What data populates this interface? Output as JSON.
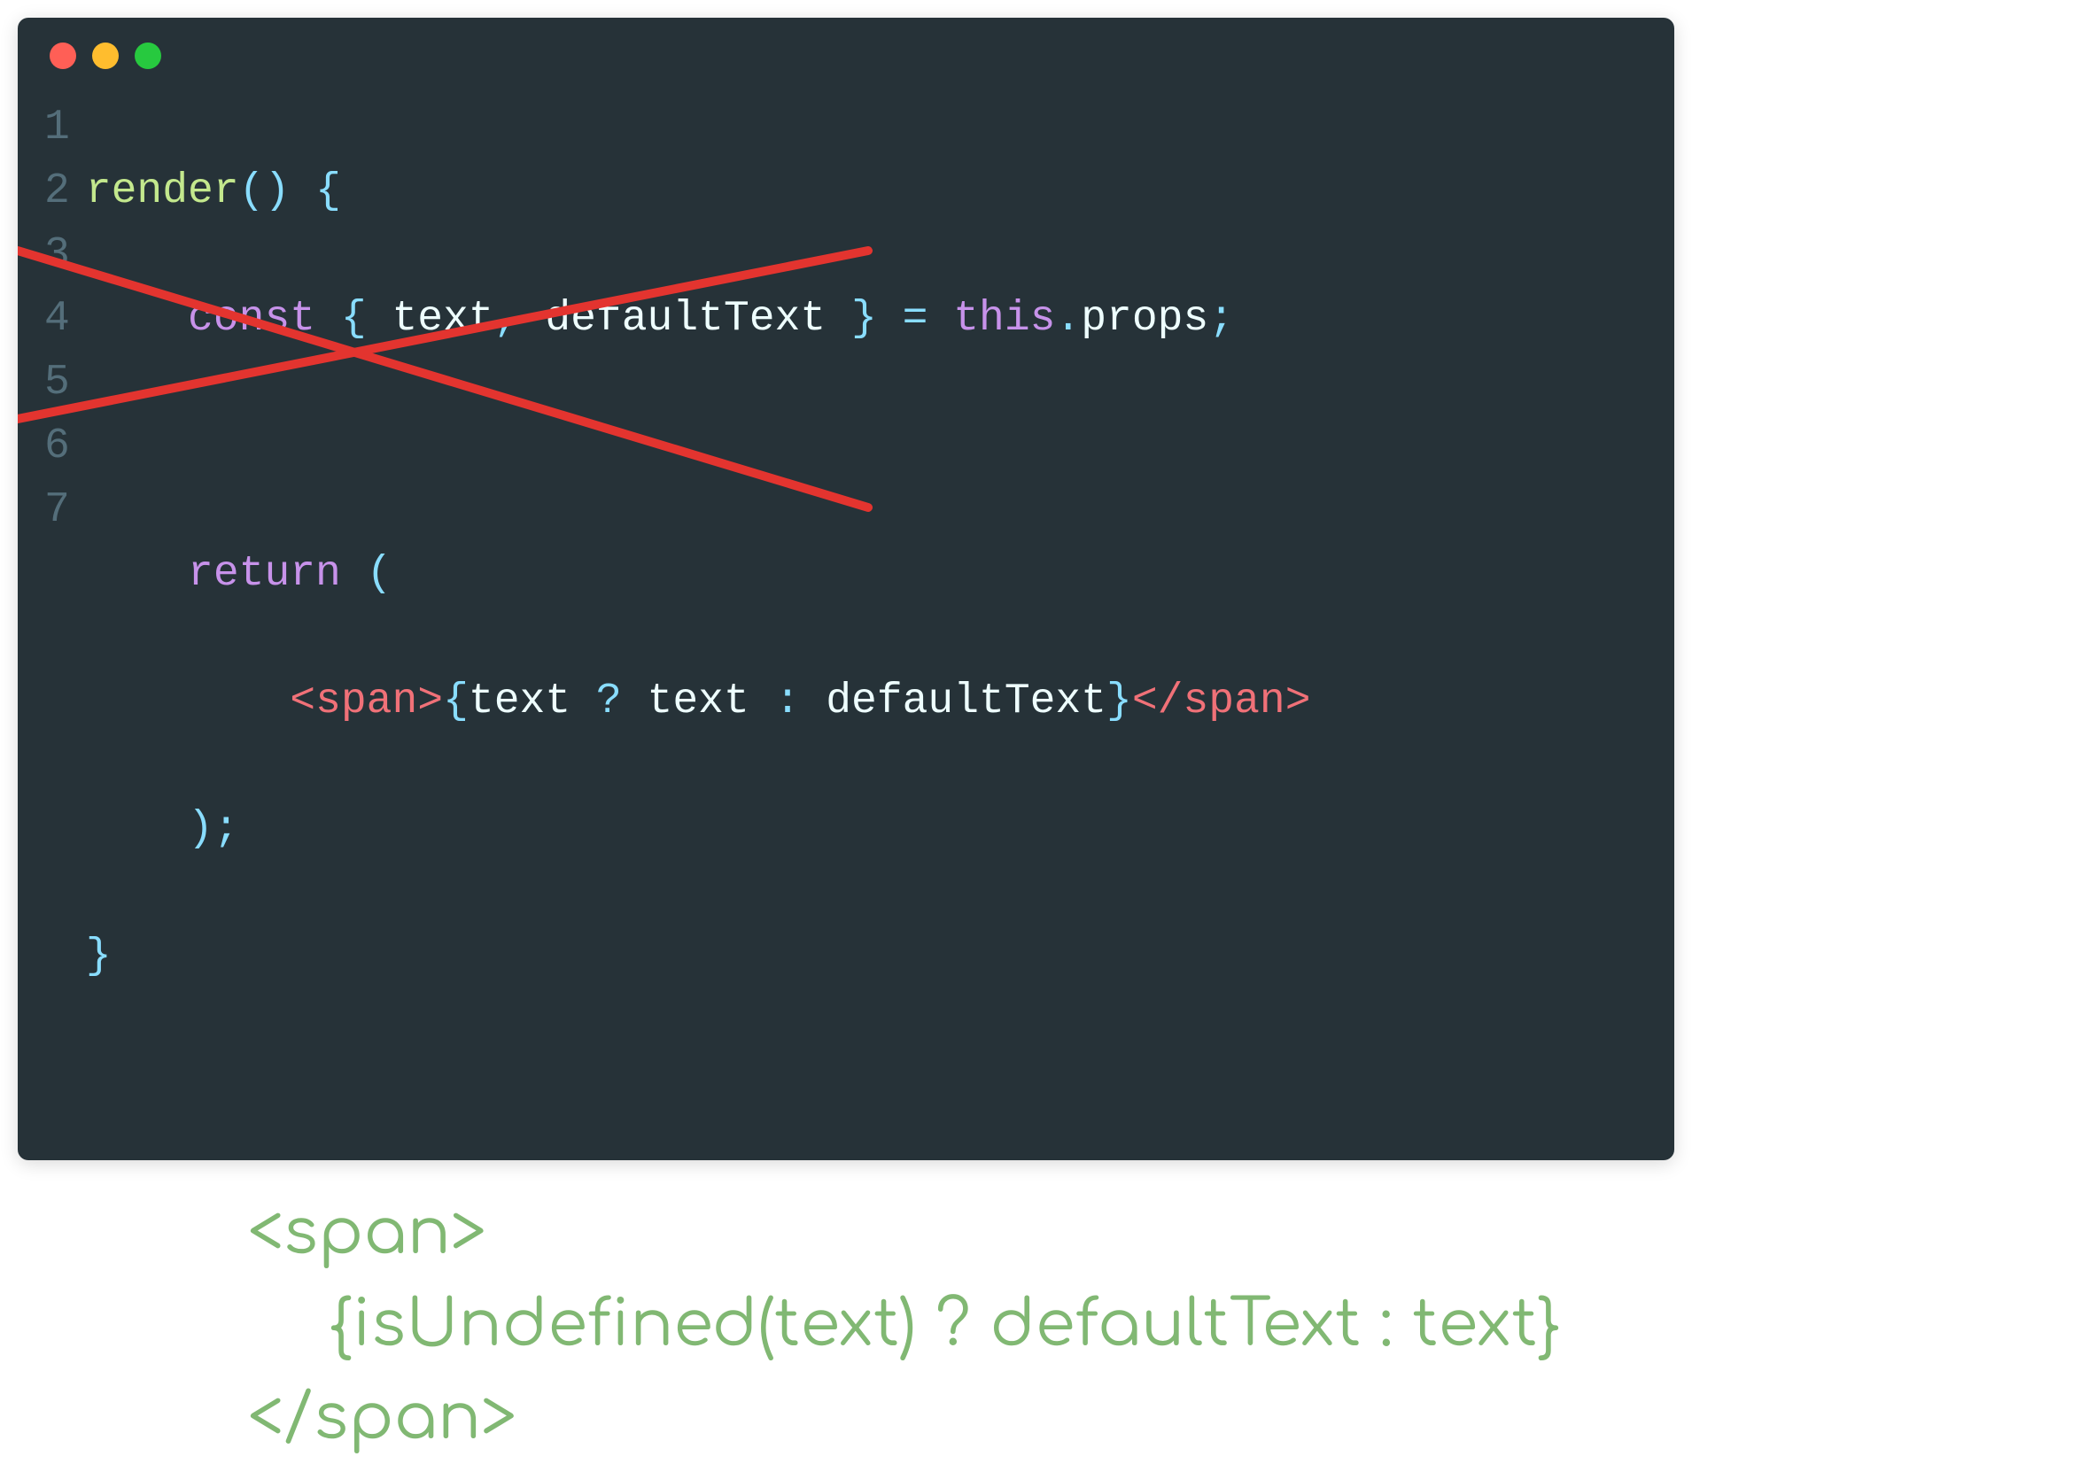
{
  "editor": {
    "lineNumbers": [
      "1",
      "2",
      "3",
      "4",
      "5",
      "6",
      "7"
    ],
    "lines": {
      "l1": {
        "render": "render",
        "paren_open": "(",
        "paren_close": ")",
        "space": " ",
        "brace_open": "{"
      },
      "l2": {
        "indent": "    ",
        "const": "const",
        "space": " ",
        "brace_open": "{ ",
        "text": "text",
        "comma": ", ",
        "defaultText": "defaultText",
        "brace_close": " }",
        "eq": " = ",
        "this": "this",
        "dot": ".",
        "props": "props",
        "semi": ";"
      },
      "l3": {
        "blank": ""
      },
      "l4": {
        "indent": "    ",
        "return": "return",
        "space": " ",
        "paren_open": "("
      },
      "l5": {
        "indent": "        ",
        "tag_open_l": "<",
        "tag_name_open": "span",
        "tag_open_r": ">",
        "brace_open": "{",
        "text1": "text",
        "q": " ? ",
        "text2": "text",
        "colon": " : ",
        "defaultText": "defaultText",
        "brace_close": "}",
        "tag_close_l": "</",
        "tag_name_close": "span",
        "tag_close_r": ">"
      },
      "l6": {
        "indent": "    ",
        "paren_close": ")",
        "semi": ";"
      },
      "l7": {
        "brace_close": "}"
      }
    }
  },
  "annotation": {
    "line1": "<span>",
    "line2": "{isUndefined(text) ? defaultText : text}",
    "line3": "</span>"
  }
}
